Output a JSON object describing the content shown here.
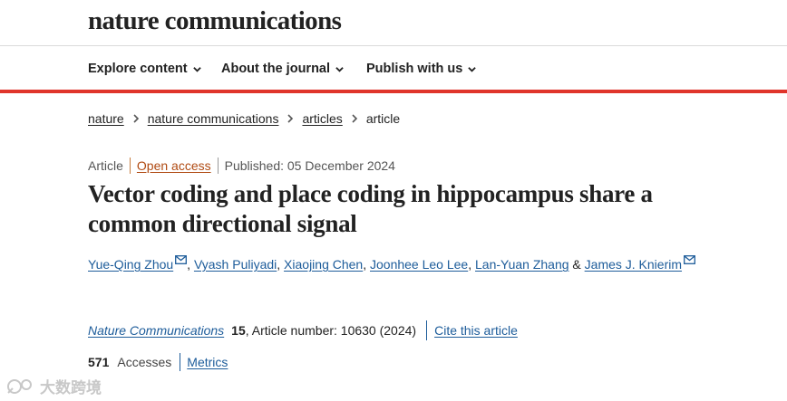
{
  "header": {
    "logo_text": "nature communications"
  },
  "nav": [
    {
      "label": "Explore content"
    },
    {
      "label": "About the journal"
    },
    {
      "label": "Publish with us"
    }
  ],
  "breadcrumb": [
    {
      "label": "nature"
    },
    {
      "label": "nature communications"
    },
    {
      "label": "articles"
    },
    {
      "label": "article"
    }
  ],
  "meta": {
    "type": "Article",
    "access": "Open access",
    "published": "Published: 05 December 2024"
  },
  "title": "Vector coding and place coding in hippocampus share a common directional signal",
  "authors": [
    {
      "name": "Yue-Qing Zhou",
      "email_icon": true
    },
    {
      "name": "Vyash Puliyadi"
    },
    {
      "name": "Xiaojing Chen"
    },
    {
      "name": "Joonhee Leo Lee"
    },
    {
      "name": "Lan-Yuan Zhang"
    },
    {
      "name": "James J. Knierim",
      "email_icon": true
    }
  ],
  "author_separators": {
    "comma": ",",
    "ampersand": "&"
  },
  "citation": {
    "journal": "Nature Communications",
    "volume": "15",
    "article_number": ", Article number: 10630 (2024)",
    "cite_link": "Cite this article"
  },
  "stats": {
    "accesses_count": "571",
    "accesses_label": "Accesses",
    "metrics_link": "Metrics"
  },
  "watermark": {
    "text": "大数跨境"
  },
  "colors": {
    "accent_red": "#e0352b",
    "link_blue": "#1d5c9a",
    "open_access": "#b04a12"
  }
}
